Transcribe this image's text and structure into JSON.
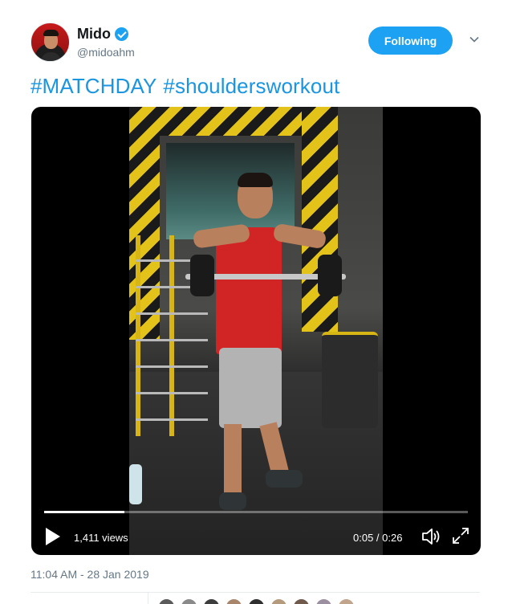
{
  "author": {
    "display_name": "Mido",
    "handle": "@midoahm",
    "verified": true,
    "avatar_icon": "user-avatar"
  },
  "follow_button": {
    "label": "Following"
  },
  "tweet": {
    "hashtags": [
      "#MATCHDAY",
      "#shoulderswork​out"
    ],
    "timestamp": "11:04 AM - 28 Jan 2019"
  },
  "video": {
    "views": "1,411 views",
    "time": "0:05 / 0:26",
    "progress_fraction": 0.19,
    "controls": {
      "play_icon": "play-icon",
      "volume_icon": "volume-icon",
      "fullscreen_icon": "fullscreen-icon"
    }
  },
  "likers": {
    "count_shown": 9
  },
  "colors": {
    "accent": "#1da1f2",
    "link": "#1b95e0",
    "muted": "#657786"
  }
}
